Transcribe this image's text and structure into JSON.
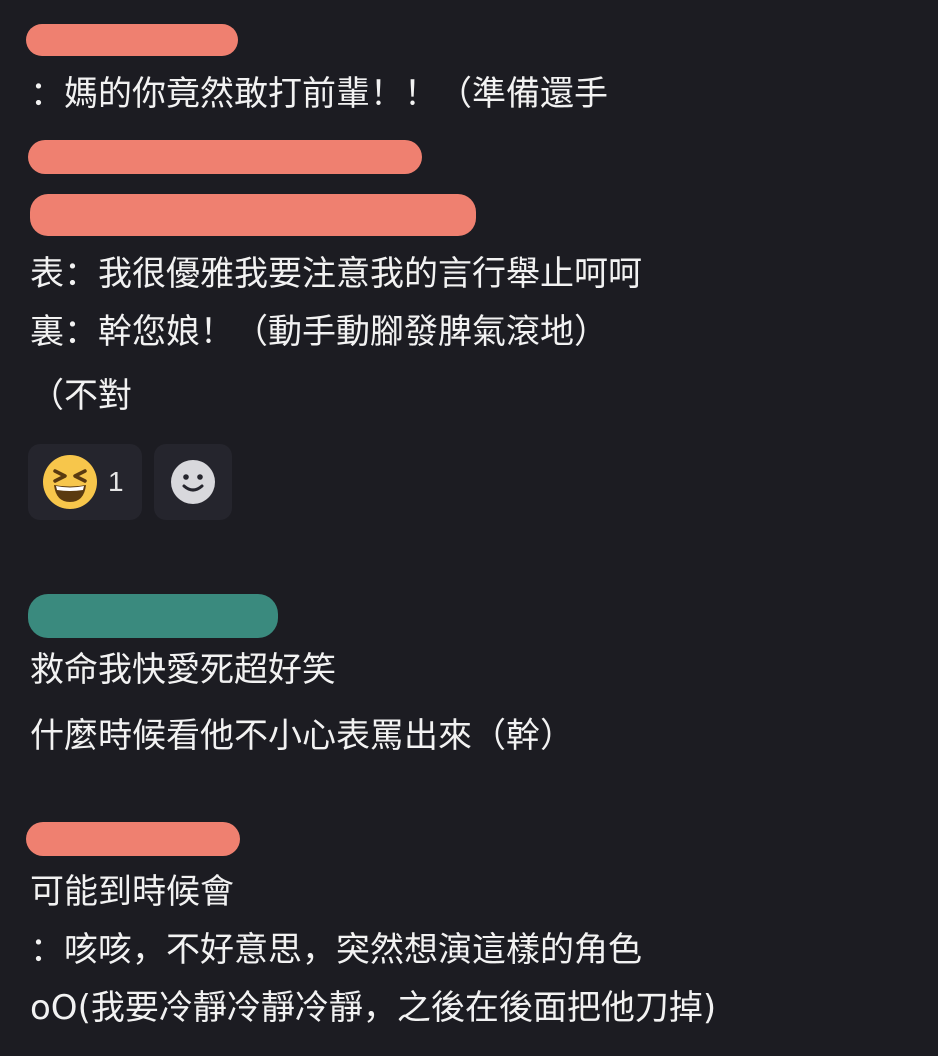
{
  "colors": {
    "background": "#1c1c22",
    "text": "#f2f2f2",
    "redact_salmon": "#ef8070",
    "redact_teal": "#3a8a7e",
    "reaction_bg": "#25252d"
  },
  "comment1": {
    "lines": [
      "：媽的你竟然敢打前輩！！（準備還手",
      "表：我很優雅我要注意我的言行舉止呵呵",
      "裏：幹您娘！（動手動腳發脾氣滾地）",
      "（不對"
    ],
    "reactions": [
      {
        "icon": "grinning-squinting-face-icon",
        "count": "1"
      },
      {
        "icon": "add-reaction-smiley-icon"
      }
    ]
  },
  "comment2": {
    "lines": [
      "救命我快愛死超好笑",
      "什麼時候看他不小心表罵出來（幹）"
    ]
  },
  "comment3": {
    "lines": [
      "可能到時候會",
      "：咳咳，不好意思，突然想演這樣的角色",
      "oO(我要冷靜冷靜冷靜，之後在後面把他刀掉)"
    ]
  }
}
